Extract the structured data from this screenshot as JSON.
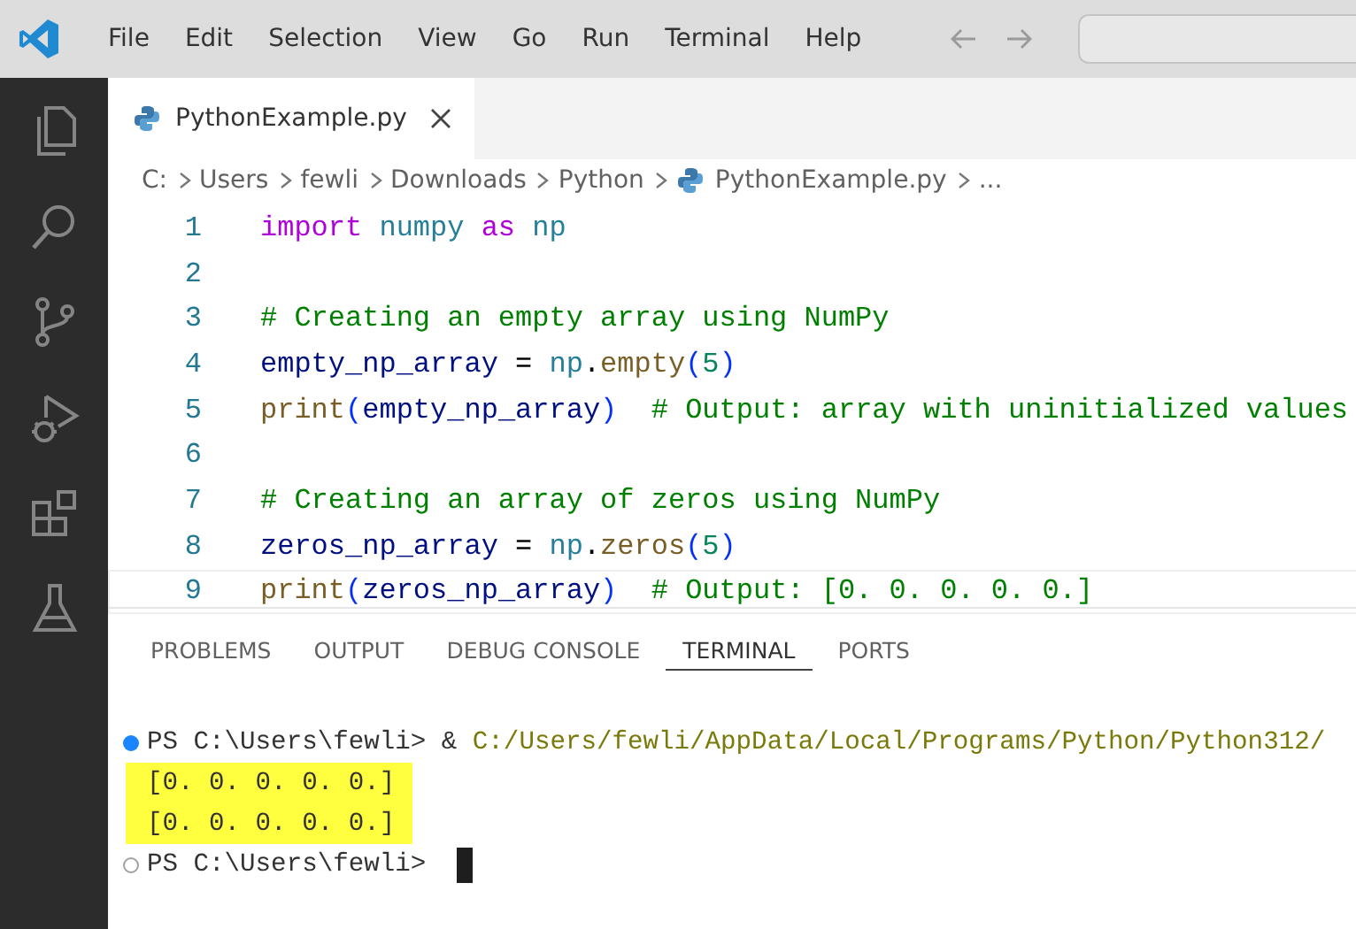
{
  "menu": [
    "File",
    "Edit",
    "Selection",
    "View",
    "Go",
    "Run",
    "Terminal",
    "Help"
  ],
  "tabs": [
    {
      "label": "PythonExample.py",
      "selected": true
    }
  ],
  "breadcrumb": [
    {
      "label": "C:",
      "kind": "folder"
    },
    {
      "label": "Users",
      "kind": "folder"
    },
    {
      "label": "fewli",
      "kind": "folder"
    },
    {
      "label": "Downloads",
      "kind": "folder"
    },
    {
      "label": "Python",
      "kind": "folder"
    },
    {
      "label": "PythonExample.py",
      "kind": "file"
    },
    {
      "label": "...",
      "kind": "more"
    }
  ],
  "code": [
    {
      "number": "1",
      "current": false,
      "tokens": [
        {
          "text": "import",
          "kind": "keyword"
        },
        {
          "text": " numpy",
          "kind": "module"
        },
        {
          "text": " as",
          "kind": "keyword"
        },
        {
          "text": " np",
          "kind": "module"
        }
      ]
    },
    {
      "number": "2",
      "current": false
    },
    {
      "number": "3",
      "current": false,
      "tokens": [
        {
          "text": "# Creating an empty array using NumPy",
          "kind": "comment"
        }
      ]
    },
    {
      "number": "4",
      "current": false,
      "tokens": [
        {
          "text": "empty_np_array",
          "kind": "variable"
        },
        {
          "text": " = ",
          "kind": "plain"
        },
        {
          "text": "np",
          "kind": "module"
        },
        {
          "text": ".",
          "kind": "plain"
        },
        {
          "text": "empty",
          "kind": "func"
        },
        {
          "text": "(",
          "kind": "bracket"
        },
        {
          "text": "5",
          "kind": "number"
        },
        {
          "text": ")",
          "kind": "bracket"
        }
      ]
    },
    {
      "number": "5",
      "current": false,
      "tokens": [
        {
          "text": "print",
          "kind": "func"
        },
        {
          "text": "(",
          "kind": "bracket"
        },
        {
          "text": "empty_np_array",
          "kind": "variable"
        },
        {
          "text": ")",
          "kind": "bracket"
        },
        {
          "text": "  # Output: array with uninitialized values",
          "kind": "comment"
        }
      ]
    },
    {
      "number": "6",
      "current": false
    },
    {
      "number": "7",
      "current": false,
      "tokens": [
        {
          "text": "# Creating an array of zeros using NumPy",
          "kind": "comment"
        }
      ]
    },
    {
      "number": "8",
      "current": false,
      "tokens": [
        {
          "text": "zeros_np_array",
          "kind": "variable"
        },
        {
          "text": " = ",
          "kind": "plain"
        },
        {
          "text": "np",
          "kind": "module"
        },
        {
          "text": ".",
          "kind": "plain"
        },
        {
          "text": "zeros",
          "kind": "func"
        },
        {
          "text": "(",
          "kind": "bracket"
        },
        {
          "text": "5",
          "kind": "number"
        },
        {
          "text": ")",
          "kind": "bracket"
        }
      ]
    },
    {
      "number": "9",
      "current": true,
      "tokens": [
        {
          "text": "print",
          "kind": "func"
        },
        {
          "text": "(",
          "kind": "bracket"
        },
        {
          "text": "zeros_np_array",
          "kind": "variable"
        },
        {
          "text": ")",
          "kind": "bracket"
        },
        {
          "text": "  # Output: [0. 0. 0. 0. 0.]",
          "kind": "comment"
        }
      ]
    }
  ],
  "panel_tabs": [
    {
      "label": "PROBLEMS",
      "selected": false
    },
    {
      "label": "OUTPUT",
      "selected": false
    },
    {
      "label": "DEBUG CONSOLE",
      "selected": false
    },
    {
      "label": "TERMINAL",
      "selected": true
    },
    {
      "label": "PORTS",
      "selected": false
    }
  ],
  "terminal": [
    {
      "kind": "prompt",
      "done": true,
      "prompt": "PS C:\\Users\\fewli>",
      "command": "& ",
      "path": "C:/Users/fewli/AppData/Local/Programs/Python/Python312/",
      "cursor": false
    },
    {
      "kind": "output",
      "text": "[0. 0. 0. 0. 0.]",
      "highlighted": true
    },
    {
      "kind": "output",
      "text": "[0. 0. 0. 0. 0.]",
      "highlighted": true
    },
    {
      "kind": "prompt",
      "done": false,
      "prompt": "PS C:\\Users\\fewli>",
      "cursor": true
    }
  ]
}
